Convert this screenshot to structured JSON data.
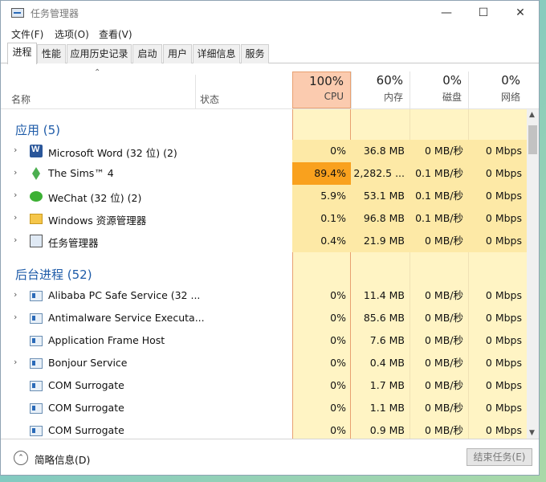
{
  "window": {
    "title": "任务管理器"
  },
  "titlebar_buttons": {
    "minimize": "—",
    "maximize": "☐",
    "close": "✕"
  },
  "menu": [
    "文件(F)",
    "选项(O)",
    "查看(V)"
  ],
  "tabs": [
    "进程",
    "性能",
    "应用历史记录",
    "启动",
    "用户",
    "详细信息",
    "服务"
  ],
  "active_tab": "进程",
  "columns": {
    "name": "名称",
    "status": "状态",
    "sort_glyph": "⌃",
    "cpu": {
      "pct": "100%",
      "label": "CPU"
    },
    "memory": {
      "pct": "60%",
      "label": "内存"
    },
    "disk": {
      "pct": "0%",
      "label": "磁盘"
    },
    "network": {
      "pct": "0%",
      "label": "网络"
    }
  },
  "expand_glyph": "›",
  "sections": {
    "apps": "应用 (5)",
    "background": "后台进程 (52)"
  },
  "apps": [
    {
      "icon": "word-icon",
      "name": "Microsoft Word (32 位) (2)",
      "cpu": "0%",
      "mem": "36.8 MB",
      "disk": "0 MB/秒",
      "net": "0 Mbps",
      "expandable": true
    },
    {
      "icon": "sims-icon",
      "name": "The Sims™ 4",
      "cpu": "89.4%",
      "mem": "2,282.5 ...",
      "disk": "0.1 MB/秒",
      "net": "0 Mbps",
      "expandable": true
    },
    {
      "icon": "wechat-icon",
      "name": "WeChat (32 位) (2)",
      "cpu": "5.9%",
      "mem": "53.1 MB",
      "disk": "0.1 MB/秒",
      "net": "0 Mbps",
      "expandable": true
    },
    {
      "icon": "explorer-icon",
      "name": "Windows 资源管理器",
      "cpu": "0.1%",
      "mem": "96.8 MB",
      "disk": "0.1 MB/秒",
      "net": "0 Mbps",
      "expandable": true
    },
    {
      "icon": "task-manager-icon",
      "name": "任务管理器",
      "cpu": "0.4%",
      "mem": "21.9 MB",
      "disk": "0 MB/秒",
      "net": "0 Mbps",
      "expandable": true
    }
  ],
  "background": [
    {
      "icon": "service-icon",
      "name": "Alibaba PC Safe Service (32 ...",
      "cpu": "0%",
      "mem": "11.4 MB",
      "disk": "0 MB/秒",
      "net": "0 Mbps",
      "expandable": true
    },
    {
      "icon": "service-icon",
      "name": "Antimalware Service Executa...",
      "cpu": "0%",
      "mem": "85.6 MB",
      "disk": "0 MB/秒",
      "net": "0 Mbps",
      "expandable": true
    },
    {
      "icon": "service-icon",
      "name": "Application Frame Host",
      "cpu": "0%",
      "mem": "7.6 MB",
      "disk": "0 MB/秒",
      "net": "0 Mbps",
      "expandable": false
    },
    {
      "icon": "service-icon",
      "name": "Bonjour Service",
      "cpu": "0%",
      "mem": "0.4 MB",
      "disk": "0 MB/秒",
      "net": "0 Mbps",
      "expandable": true
    },
    {
      "icon": "service-icon",
      "name": "COM Surrogate",
      "cpu": "0%",
      "mem": "1.7 MB",
      "disk": "0 MB/秒",
      "net": "0 Mbps",
      "expandable": false
    },
    {
      "icon": "service-icon",
      "name": "COM Surrogate",
      "cpu": "0%",
      "mem": "1.1 MB",
      "disk": "0 MB/秒",
      "net": "0 Mbps",
      "expandable": false
    },
    {
      "icon": "service-icon",
      "name": "COM Surrogate",
      "cpu": "0%",
      "mem": "0.9 MB",
      "disk": "0 MB/秒",
      "net": "0 Mbps",
      "expandable": false
    }
  ],
  "footer": {
    "fewer_details": "简略信息(D)",
    "end_task": "结束任务(E)",
    "fold_glyph": "⌃"
  },
  "colors": {
    "heat_light": "#fff4c4",
    "heat_mid": "#fde9a6",
    "heat_cpu_high": "#f9a11e",
    "cpu_header": "#fbcbaf",
    "section_title": "#1e5ba8"
  }
}
